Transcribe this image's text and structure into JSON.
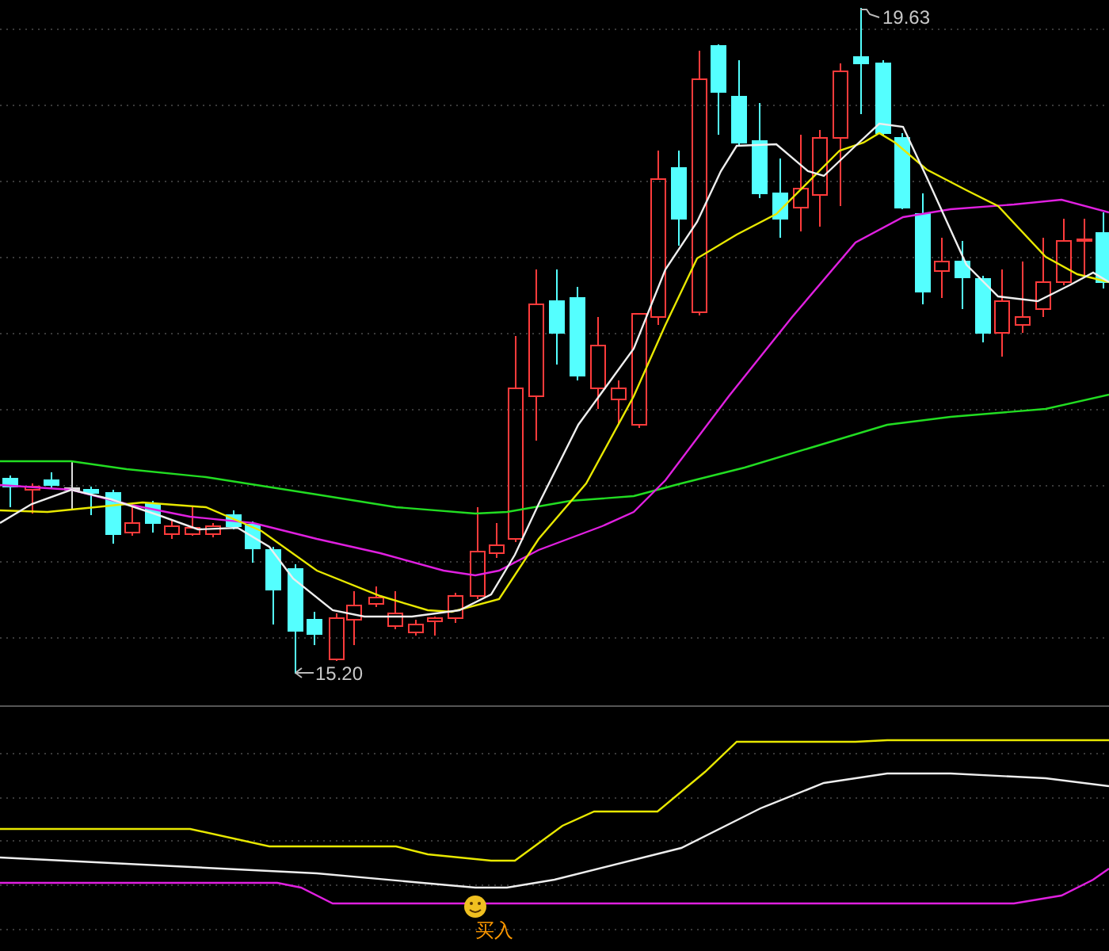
{
  "price_chart": {
    "high_label": "19.63",
    "low_label": "15.20"
  },
  "indicator_panel": {
    "signal_label": "买入"
  }
}
